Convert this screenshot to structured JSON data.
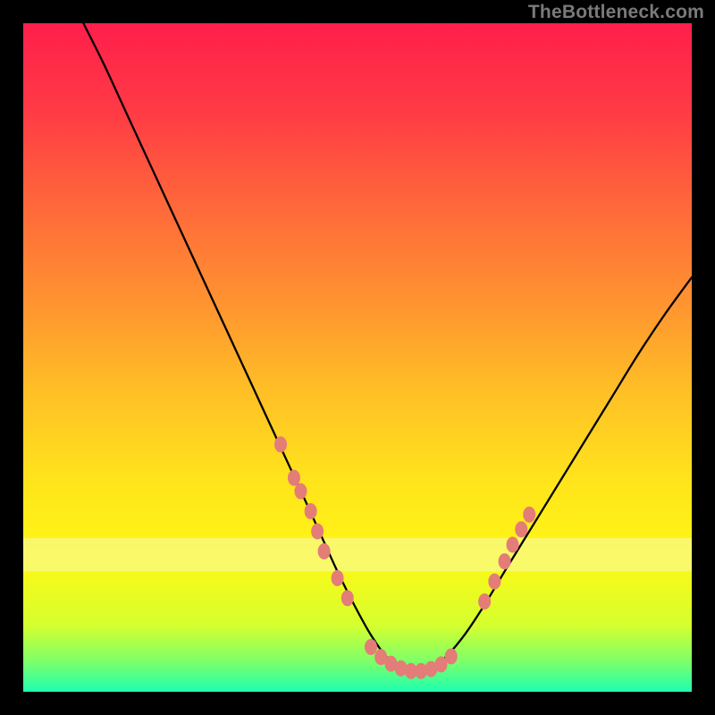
{
  "watermark": "TheBottleneck.com",
  "chart_data": {
    "type": "line",
    "title": "",
    "xlabel": "",
    "ylabel": "",
    "xlim": [
      0,
      100
    ],
    "ylim": [
      0,
      100
    ],
    "grid": false,
    "legend": false,
    "background_gradient": {
      "stops": [
        {
          "offset": 0.0,
          "color": "#ff1f4b"
        },
        {
          "offset": 0.13,
          "color": "#ff3a45"
        },
        {
          "offset": 0.28,
          "color": "#ff6a3a"
        },
        {
          "offset": 0.42,
          "color": "#ff9430"
        },
        {
          "offset": 0.55,
          "color": "#ffbf26"
        },
        {
          "offset": 0.68,
          "color": "#ffe31c"
        },
        {
          "offset": 0.8,
          "color": "#fff714"
        },
        {
          "offset": 0.9,
          "color": "#d6ff2e"
        },
        {
          "offset": 0.955,
          "color": "#7dff6a"
        },
        {
          "offset": 1.0,
          "color": "#1dffb0"
        }
      ]
    },
    "series": [
      {
        "name": "bottleneck-curve",
        "stroke": "#000000",
        "stroke_width": 2.3,
        "x": [
          9,
          12,
          15,
          18,
          21,
          24,
          27,
          30,
          33,
          36,
          39,
          42,
          44.5,
          47,
          49.5,
          52,
          54.5,
          57,
          60,
          63,
          66,
          69,
          72,
          76,
          80,
          84,
          88,
          92,
          96,
          100
        ],
        "y": [
          100,
          94,
          87.5,
          81,
          74.5,
          68,
          61.5,
          55,
          48.5,
          42,
          35.5,
          29,
          23.5,
          18,
          13,
          8.5,
          5,
          3,
          3,
          5,
          8.5,
          13,
          18,
          24.5,
          31,
          37.5,
          44,
          50.5,
          56.5,
          62
        ]
      }
    ],
    "highlight_band": {
      "y_from": 18,
      "y_to": 23,
      "color": "#f6fcb0",
      "opacity": 0.55
    },
    "scatter": {
      "name": "data-points",
      "color": "#e47c78",
      "points": [
        {
          "x": 38.5,
          "y": 37
        },
        {
          "x": 40.5,
          "y": 32
        },
        {
          "x": 41.5,
          "y": 30
        },
        {
          "x": 43.0,
          "y": 27
        },
        {
          "x": 44.0,
          "y": 24
        },
        {
          "x": 45.0,
          "y": 21
        },
        {
          "x": 47.0,
          "y": 17
        },
        {
          "x": 48.5,
          "y": 14
        },
        {
          "x": 52.0,
          "y": 6.7
        },
        {
          "x": 53.5,
          "y": 5.2
        },
        {
          "x": 55.0,
          "y": 4.2
        },
        {
          "x": 56.5,
          "y": 3.5
        },
        {
          "x": 58.0,
          "y": 3.1
        },
        {
          "x": 59.5,
          "y": 3.1
        },
        {
          "x": 61.0,
          "y": 3.4
        },
        {
          "x": 62.5,
          "y": 4.1
        },
        {
          "x": 64.0,
          "y": 5.3
        },
        {
          "x": 69.0,
          "y": 13.5
        },
        {
          "x": 70.5,
          "y": 16.5
        },
        {
          "x": 72.0,
          "y": 19.5
        },
        {
          "x": 73.2,
          "y": 22
        },
        {
          "x": 74.5,
          "y": 24.3
        },
        {
          "x": 75.7,
          "y": 26.5
        }
      ]
    }
  }
}
